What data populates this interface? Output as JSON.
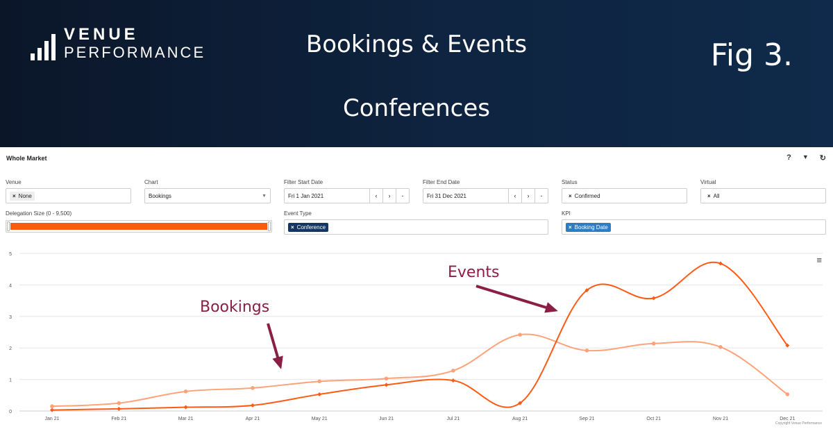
{
  "banner": {
    "logo_top": "VENUE",
    "logo_bottom": "PERFORMANCE",
    "title": "Bookings & Events",
    "subtitle": "Conferences",
    "fig": "Fig 3."
  },
  "panel": {
    "title": "Whole Market",
    "icons": [
      "help-icon",
      "filter-icon",
      "refresh-icon"
    ],
    "help_glyph": "?",
    "filter_glyph": "▼",
    "refresh_glyph": "↻"
  },
  "filters": {
    "venue": {
      "label": "Venue",
      "value": "None"
    },
    "chart": {
      "label": "Chart",
      "value": "Bookings"
    },
    "start": {
      "label": "Filter Start Date",
      "value": "Fri 1 Jan 2021"
    },
    "end": {
      "label": "Filter End Date",
      "value": "Fri 31 Dec 2021"
    },
    "status": {
      "label": "Status",
      "value": "Confirmed"
    },
    "virtual": {
      "label": "Virtual",
      "value": "All"
    },
    "delegation": {
      "label": "Delegation Size (0 - 9,500)"
    },
    "event_type": {
      "label": "Event Type",
      "value": "Conference"
    },
    "kpi": {
      "label": "KPI",
      "value": "Booking Date"
    },
    "remove_glyph": "×",
    "prev_glyph": "‹",
    "next_glyph": "›",
    "clear_glyph": "-"
  },
  "annotations": {
    "bookings": "Bookings",
    "events": "Events"
  },
  "copyright": "Copyright Venue Performance",
  "colors": {
    "events": "#ff5a14",
    "bookings": "#ffa27a",
    "arrow": "#8a1e44",
    "accent_dark": "#15365f",
    "accent_blue": "#2f7dc0"
  },
  "chart_data": {
    "type": "line",
    "categories": [
      "Jan 21",
      "Feb 21",
      "Mar 21",
      "Apr 21",
      "May 21",
      "Jun 21",
      "Jul 21",
      "Aug 21",
      "Sep 21",
      "Oct 21",
      "Nov 21",
      "Dec 21"
    ],
    "y_ticks": [
      "0",
      "1",
      "2",
      "3",
      "4",
      "5"
    ],
    "ylim": [
      0,
      5
    ],
    "grid": true,
    "series": [
      {
        "key": "bookings",
        "values": [
          0.15,
          0.25,
          0.62,
          0.73,
          0.94,
          1.03,
          1.28,
          2.42,
          1.92,
          2.14,
          2.03,
          0.53
        ]
      },
      {
        "key": "events",
        "values": [
          0.03,
          0.07,
          0.12,
          0.18,
          0.53,
          0.83,
          0.97,
          0.25,
          3.83,
          3.58,
          4.68,
          2.08
        ]
      }
    ]
  }
}
